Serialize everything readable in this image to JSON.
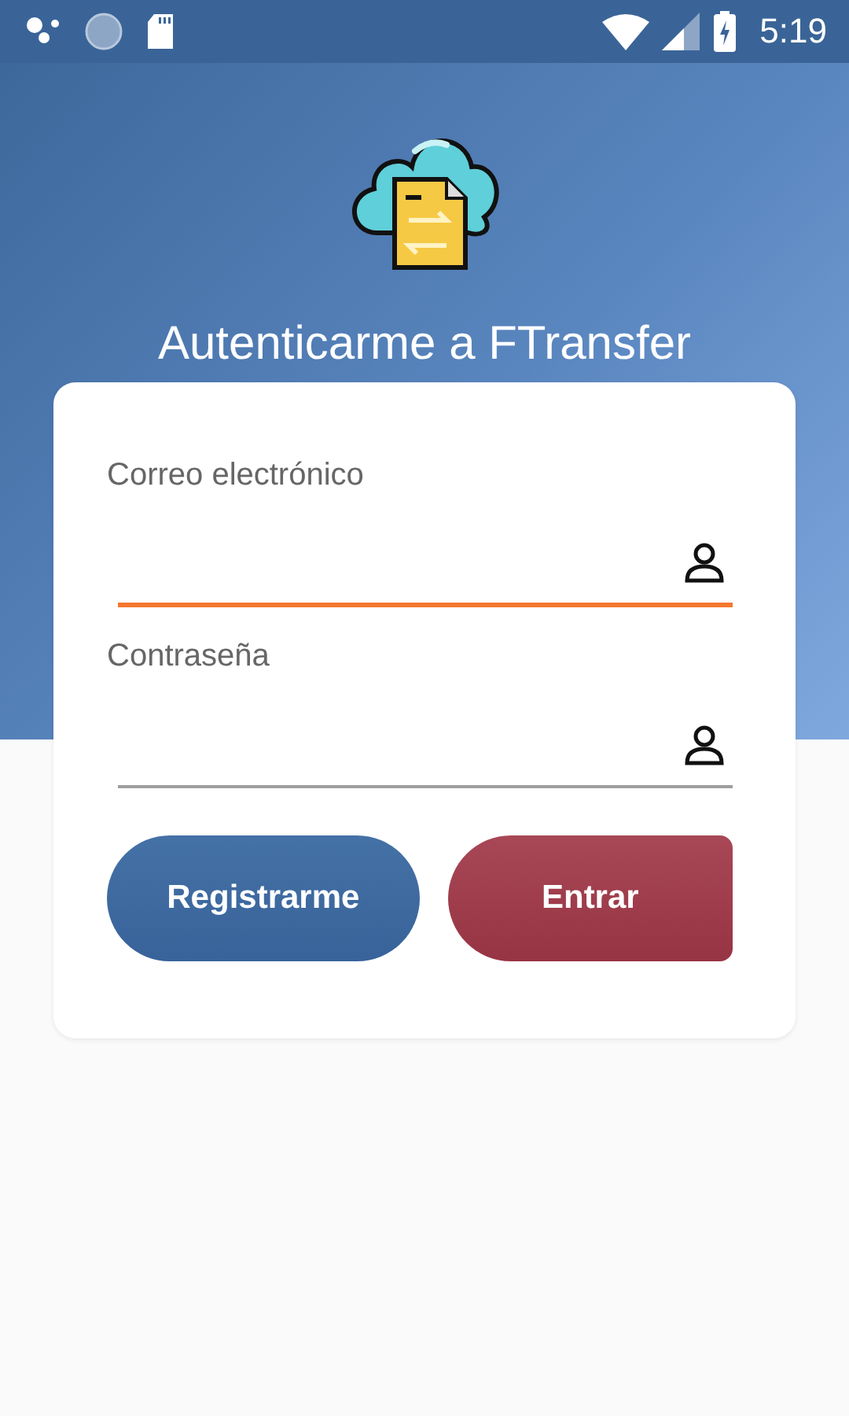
{
  "status_bar": {
    "time": "5:19"
  },
  "title": "Autenticarme a FTransfer",
  "fields": [
    {
      "label": "Correo electrónico",
      "focused": true
    },
    {
      "label": "Contraseña",
      "focused": false
    }
  ],
  "buttons": [
    {
      "label": "Registrarme",
      "kind": "secondary"
    },
    {
      "label": "Entrar",
      "kind": "primary"
    }
  ]
}
